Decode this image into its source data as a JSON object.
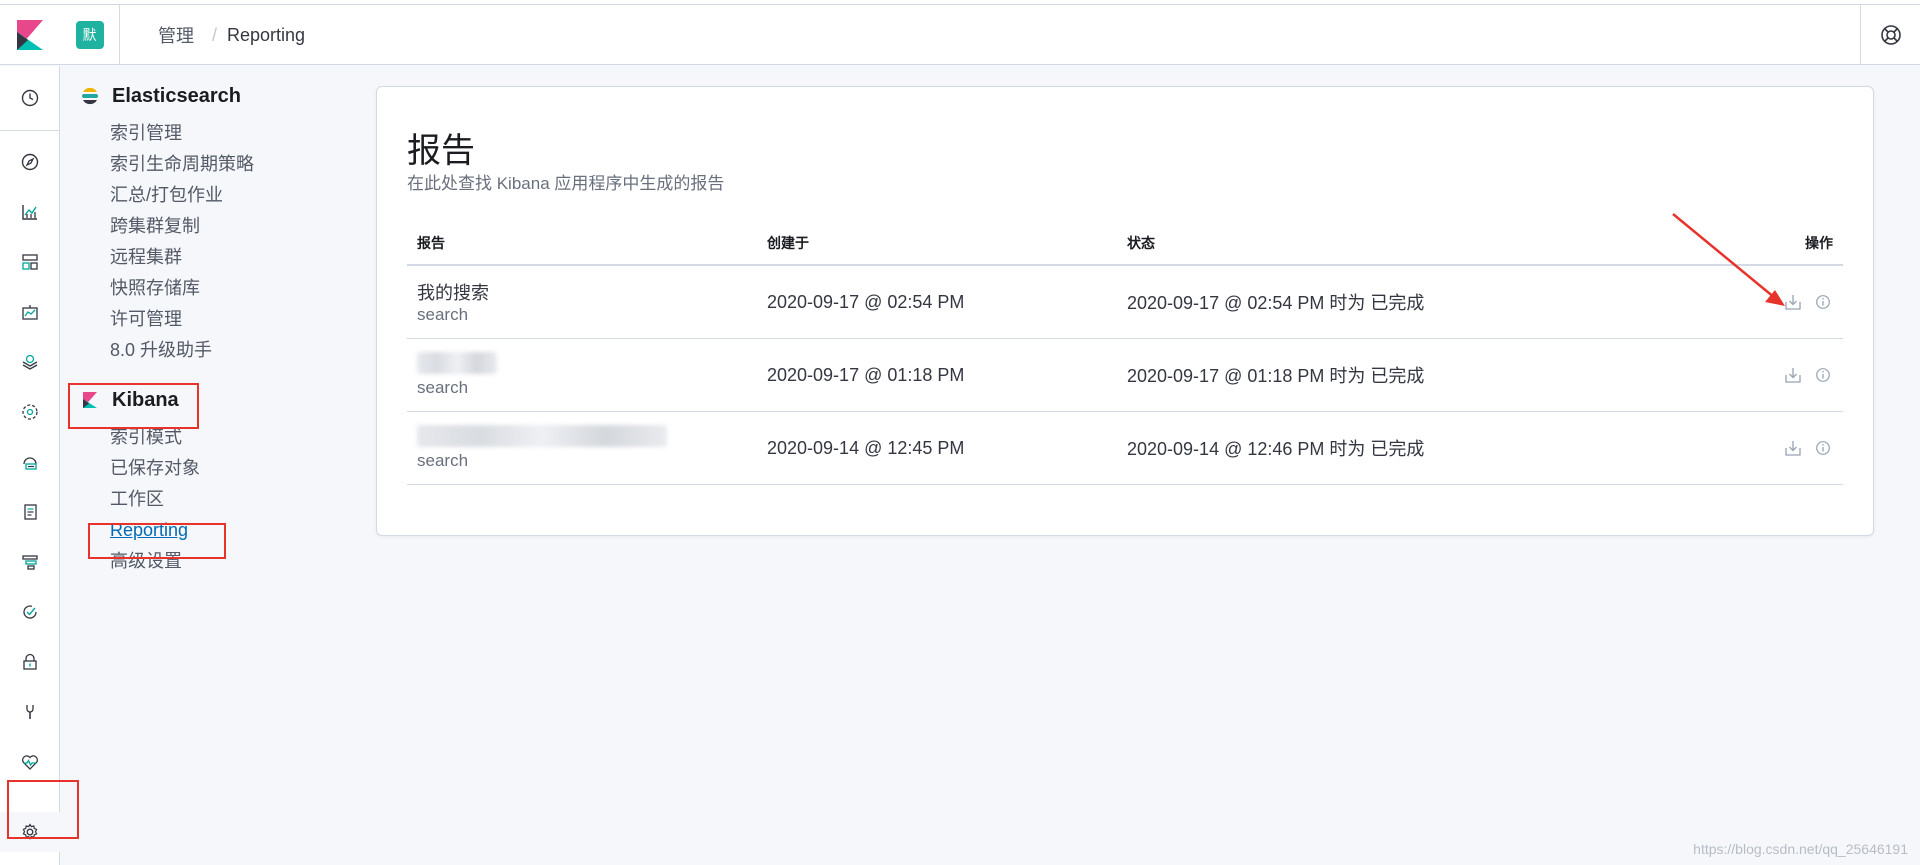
{
  "header": {
    "space_initial": "默",
    "breadcrumbs": [
      {
        "label": "管理"
      },
      {
        "label": "Reporting"
      }
    ]
  },
  "nav": {
    "icons": [
      "recent-icon",
      "discover-icon",
      "visualize-icon",
      "dashboard-icon",
      "canvas-icon",
      "maps-icon",
      "machine-learning-icon",
      "infrastructure-icon",
      "logs-icon",
      "apm-icon",
      "uptime-icon",
      "siem-icon",
      "dev-tools-icon",
      "monitoring-icon",
      "management-icon"
    ]
  },
  "sidebar": {
    "elasticsearch": {
      "title": "Elasticsearch",
      "items": [
        "索引管理",
        "索引生命周期策略",
        "汇总/打包作业",
        "跨集群复制",
        "远程集群",
        "快照存储库",
        "许可管理",
        "8.0 升级助手"
      ]
    },
    "kibana": {
      "title": "Kibana",
      "items": [
        "索引模式",
        "已保存对象",
        "工作区",
        "Reporting",
        "高级设置"
      ],
      "selected": "Reporting"
    }
  },
  "main": {
    "title": "报告",
    "description": "在此处查找 Kibana 应用程序中生成的报告",
    "table": {
      "headers": [
        "报告",
        "创建于",
        "状态",
        "操作"
      ],
      "rows": [
        {
          "name": "我的搜索",
          "type": "search",
          "created": "2020-09-17 @ 02:54 PM",
          "status": "2020-09-17 @ 02:54 PM 时为 已完成"
        },
        {
          "name": "",
          "type": "search",
          "created": "2020-09-17 @ 01:18 PM",
          "status": "2020-09-17 @ 01:18 PM 时为 已完成"
        },
        {
          "name": "",
          "type": "search",
          "created": "2020-09-14 @ 12:45 PM",
          "status": "2020-09-14 @ 12:46 PM 时为 已完成"
        }
      ]
    }
  },
  "annotation": {
    "color": "#e7332b"
  },
  "watermark": "https://blog.csdn.net/qq_25646191"
}
